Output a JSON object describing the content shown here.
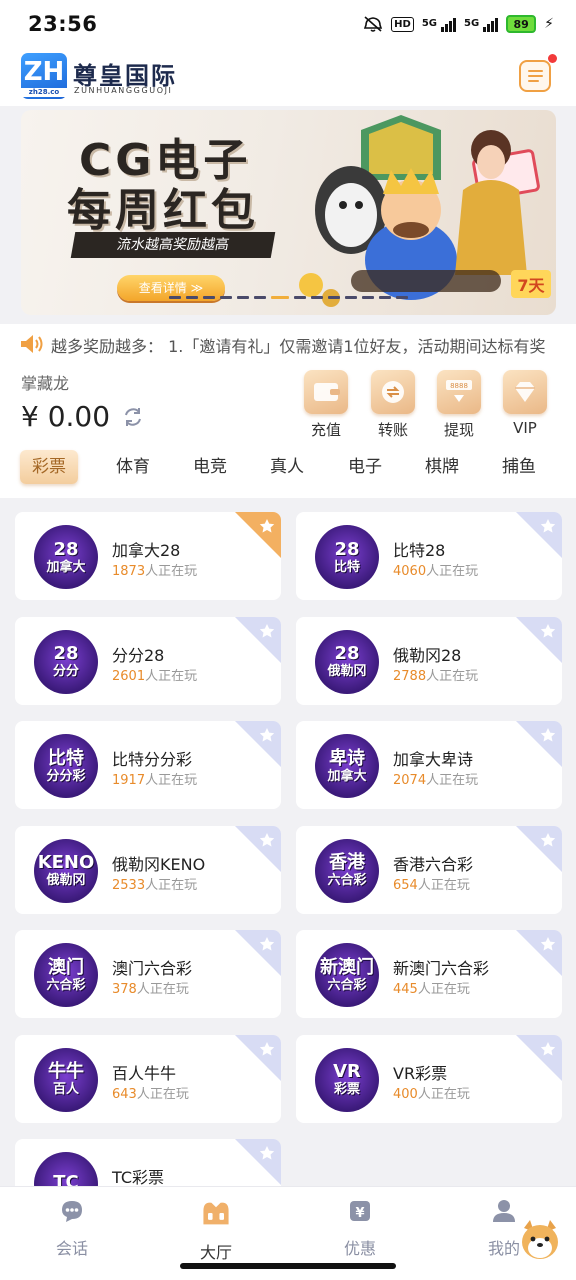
{
  "status_bar": {
    "time": "23:56",
    "hd": "HD",
    "net1": "5G",
    "net2": "5G",
    "battery": "89"
  },
  "header": {
    "logo_text": "ZH",
    "logo_sub": "zh28.co",
    "brand_name": "尊皇国际",
    "brand_en": "ZUNHUANGGGUOJI"
  },
  "banner": {
    "title_line1": "CG电子",
    "title_line2": "每周红包",
    "subtitle": "流水越高奖励越高",
    "cta": "查看详情 ≫",
    "badge": "7天"
  },
  "marquee": {
    "text": "越多奖励越多： 1.「邀请有礼」仅需邀请1位好友，活动期间达标有奖"
  },
  "wallet": {
    "username": "掌藏龙",
    "balance": "¥ 0.00",
    "actions": [
      {
        "label": "充值",
        "icon": "wallet-icon"
      },
      {
        "label": "转账",
        "icon": "transfer-icon"
      },
      {
        "label": "提现",
        "icon": "withdraw-icon"
      },
      {
        "label": "VIP",
        "icon": "vip-icon"
      }
    ]
  },
  "tabs": [
    "彩票",
    "体育",
    "电竞",
    "真人",
    "电子",
    "棋牌",
    "捕鱼"
  ],
  "games": [
    {
      "name": "加拿大28",
      "count": "1873",
      "suffix": "人正在玩",
      "logo1": "28",
      "logo2": "加拿大",
      "hot": true
    },
    {
      "name": "比特28",
      "count": "4060",
      "suffix": "人正在玩",
      "logo1": "28",
      "logo2": "比特",
      "hot": false
    },
    {
      "name": "分分28",
      "count": "2601",
      "suffix": "人正在玩",
      "logo1": "28",
      "logo2": "分分",
      "hot": false
    },
    {
      "name": "俄勒冈28",
      "count": "2788",
      "suffix": "人正在玩",
      "logo1": "28",
      "logo2": "俄勒冈",
      "hot": false
    },
    {
      "name": "比特分分彩",
      "count": "1917",
      "suffix": "人正在玩",
      "logo1": "比特",
      "logo2": "分分彩",
      "hot": false
    },
    {
      "name": "加拿大卑诗",
      "count": "2074",
      "suffix": "人正在玩",
      "logo1": "卑诗",
      "logo2": "加拿大",
      "hot": false
    },
    {
      "name": "俄勒冈KENO",
      "count": "2533",
      "suffix": "人正在玩",
      "logo1": "KENO",
      "logo2": "俄勒冈",
      "hot": false
    },
    {
      "name": "香港六合彩",
      "count": "654",
      "suffix": "人正在玩",
      "logo1": "香港",
      "logo2": "六合彩",
      "hot": false
    },
    {
      "name": "澳门六合彩",
      "count": "378",
      "suffix": "人正在玩",
      "logo1": "澳门",
      "logo2": "六合彩",
      "hot": false
    },
    {
      "name": "新澳门六合彩",
      "count": "445",
      "suffix": "人正在玩",
      "logo1": "新澳门",
      "logo2": "六合彩",
      "hot": false
    },
    {
      "name": "百人牛牛",
      "count": "643",
      "suffix": "人正在玩",
      "logo1": "牛牛",
      "logo2": "百人",
      "hot": false
    },
    {
      "name": "VR彩票",
      "count": "400",
      "suffix": "人正在玩",
      "logo1": "VR",
      "logo2": "彩票",
      "hot": false
    },
    {
      "name": "TC彩票",
      "count": "",
      "suffix": "",
      "logo1": "TC",
      "logo2": "",
      "hot": false
    }
  ],
  "bottom_nav": [
    {
      "label": "会话",
      "icon": "chat-icon",
      "active": false
    },
    {
      "label": "大厅",
      "icon": "lobby-icon",
      "active": true
    },
    {
      "label": "优惠",
      "icon": "promo-icon",
      "active": false
    },
    {
      "label": "我的",
      "icon": "profile-icon",
      "active": false
    }
  ],
  "colors": {
    "accent": "#f0a043",
    "count": "#e88b2b",
    "corner_hot": "#f3b061",
    "corner_default": "#d8dcf4"
  }
}
